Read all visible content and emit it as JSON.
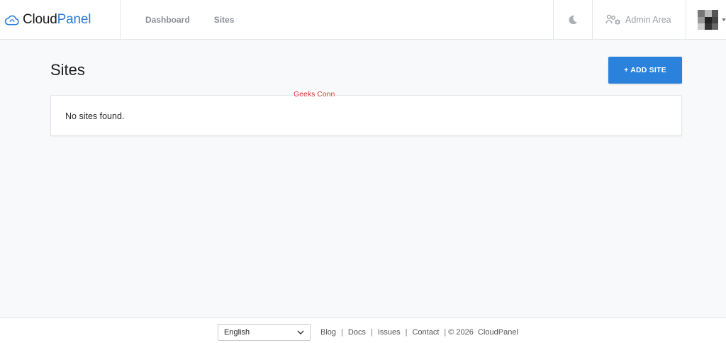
{
  "brand": {
    "name_part1": "Cloud",
    "name_part2": "Panel",
    "icon": "cloud-icon"
  },
  "nav": {
    "items": [
      {
        "label": "Dashboard"
      },
      {
        "label": "Sites"
      }
    ]
  },
  "header": {
    "theme_icon": "moon-icon",
    "admin_label": "Admin Area",
    "admin_icon": "users-gear-icon",
    "avatar_icon": "avatar",
    "menu_icon": "caret-down-icon"
  },
  "main": {
    "title": "Sites",
    "add_button_label": "+ ADD SITE",
    "empty_message": "No sites found.",
    "watermark": "Geeks Conn"
  },
  "footer": {
    "language": "English",
    "links": [
      "Blog",
      "Docs",
      "Issues",
      "Contact"
    ],
    "copyright": "© 2026",
    "copyright_name": "CloudPanel"
  },
  "colors": {
    "primary": "#2b82dc",
    "brand_accent": "#2c7dd8",
    "background": "#f8f9fb"
  }
}
